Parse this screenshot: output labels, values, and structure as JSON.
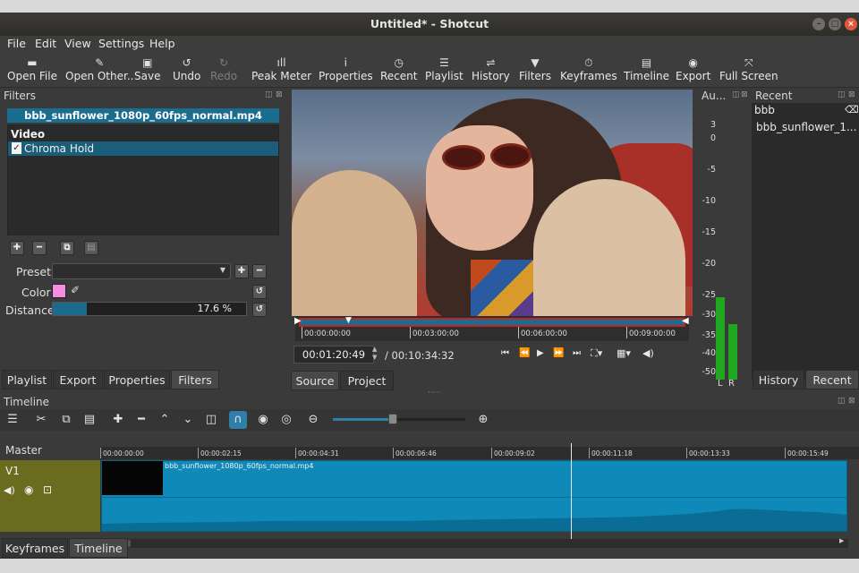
{
  "window": {
    "title": "Untitled* - Shotcut"
  },
  "menu": [
    "File",
    "Edit",
    "View",
    "Settings",
    "Help"
  ],
  "toolbar": [
    {
      "label": "Open File",
      "icon": "folder-icon",
      "glyph": "▬",
      "enabled": true
    },
    {
      "label": "Open Other..",
      "icon": "open-other-icon",
      "glyph": "✎",
      "enabled": true
    },
    {
      "label": "Save",
      "icon": "save-icon",
      "glyph": "▣",
      "enabled": true
    },
    {
      "label": "Undo",
      "icon": "undo-icon",
      "glyph": "↺",
      "enabled": true
    },
    {
      "label": "Redo",
      "icon": "redo-icon",
      "glyph": "↻",
      "enabled": false
    },
    {
      "label": "Peak Meter",
      "icon": "peak-meter-icon",
      "glyph": "ıll",
      "enabled": true
    },
    {
      "label": "Properties",
      "icon": "info-icon",
      "glyph": "i",
      "enabled": true
    },
    {
      "label": "Recent",
      "icon": "clock-icon",
      "glyph": "◷",
      "enabled": true
    },
    {
      "label": "Playlist",
      "icon": "playlist-icon",
      "glyph": "☰",
      "enabled": true
    },
    {
      "label": "History",
      "icon": "history-icon",
      "glyph": "⇌",
      "enabled": true
    },
    {
      "label": "Filters",
      "icon": "funnel-icon",
      "glyph": "▼",
      "enabled": true
    },
    {
      "label": "Keyframes",
      "icon": "stopwatch-icon",
      "glyph": "⏱",
      "enabled": true
    },
    {
      "label": "Timeline",
      "icon": "timeline-icon",
      "glyph": "▤",
      "enabled": true
    },
    {
      "label": "Export",
      "icon": "export-icon",
      "glyph": "◉",
      "enabled": true
    },
    {
      "label": "Full Screen",
      "icon": "fullscreen-icon",
      "glyph": "⤧",
      "enabled": true
    }
  ],
  "filters_panel": {
    "title": "Filters",
    "clip_name": "bbb_sunflower_1080p_60fps_normal.mp4",
    "section": "Video",
    "items": [
      {
        "label": "Chroma Hold",
        "checked": true
      }
    ],
    "preset_label": "Preset",
    "preset_value": "",
    "color_label": "Color",
    "color_value": "#f48ce0",
    "distance_label": "Distance",
    "distance_value": "17.6 %",
    "distance_fraction": 0.176
  },
  "left_tabs": [
    {
      "label": "Playlist",
      "active": false
    },
    {
      "label": "Export",
      "active": false
    },
    {
      "label": "Properties",
      "active": false
    },
    {
      "label": "Filters",
      "active": true
    }
  ],
  "player": {
    "ruler_ticks": [
      "00:00:00:00",
      "00:03:00:00",
      "00:06:00:00",
      "00:09:00:00"
    ],
    "position": "00:01:20:49",
    "duration": "/ 00:10:34:32",
    "source_tabs": [
      {
        "label": "Source",
        "active": true
      },
      {
        "label": "Project",
        "active": false
      }
    ]
  },
  "audio": {
    "title": "Au...",
    "scale": [
      "3",
      "0",
      "-5",
      "-10",
      "-15",
      "-20",
      "-25",
      "-30",
      "-35",
      "-40",
      "-50"
    ],
    "channels": [
      {
        "label": "L",
        "level_db": -29
      },
      {
        "label": "R",
        "level_db": -34
      }
    ]
  },
  "recent_panel": {
    "title": "Recent",
    "search": "bbb",
    "items": [
      "bbb_sunflower_1..."
    ],
    "tabs": [
      {
        "label": "History",
        "active": false
      },
      {
        "label": "Recent",
        "active": true
      }
    ]
  },
  "timeline": {
    "title": "Timeline",
    "master_label": "Master",
    "track_name": "V1",
    "ticks": [
      "00:00:00:00",
      "00:00:02:15",
      "00:00:04:31",
      "00:00:06:46",
      "00:00:09:02",
      "00:00:11:18",
      "00:00:13:33",
      "00:00:15:49"
    ],
    "clip_name": "bbb_sunflower_1080p_60fps_normal.mp4",
    "playhead_time_fraction": 0.63,
    "zoom_fraction": 0.45
  },
  "bottom_tabs": [
    {
      "label": "Keyframes",
      "active": false
    },
    {
      "label": "Timeline",
      "active": true
    }
  ],
  "colors": {
    "accent": "#1b6d8f",
    "clip_blue": "#0f8ab8",
    "track_olive": "#6b6b20",
    "meter_green": "#1faa1f",
    "playhead_red": "#d42a2a"
  }
}
